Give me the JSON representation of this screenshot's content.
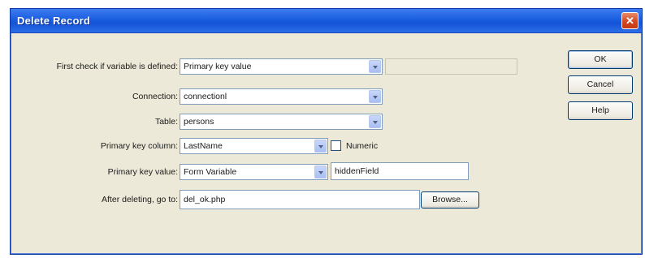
{
  "window": {
    "title": "Delete Record",
    "close_glyph": "✕"
  },
  "form": {
    "check_label": "First check if variable is defined:",
    "check_value": "Primary key value",
    "connection_label": "Connection:",
    "connection_value": "connectionl",
    "table_label": "Table:",
    "table_value": "persons",
    "pk_column_label": "Primary key column:",
    "pk_column_value": "LastName",
    "numeric_label": "Numeric",
    "numeric_checked": false,
    "pk_value_label": "Primary key value:",
    "pk_value_value": "Form Variable",
    "pk_value_input": "hiddenField",
    "after_label": "After deleting, go to:",
    "after_value": "del_ok.php",
    "browse_label": "Browse..."
  },
  "buttons": {
    "ok": "OK",
    "cancel": "Cancel",
    "help": "Help"
  },
  "icons": {
    "close": "close-icon",
    "dropdown": "chevron-down-icon"
  },
  "colors": {
    "titlebar": "#1553d6",
    "close": "#d3471f",
    "dialog_bg": "#ece9d8",
    "field_border": "#7f9db9"
  }
}
